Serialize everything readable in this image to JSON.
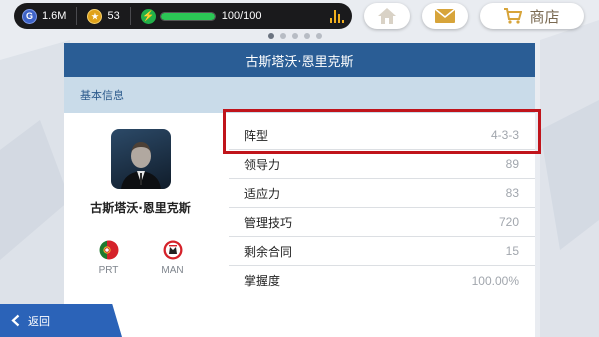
{
  "topbar": {
    "gold_icon_letter": "G",
    "gold_value": "1.6M",
    "coin_icon": "star-coin-icon",
    "coin_value": "53",
    "energy_icon": "lightning-icon",
    "energy_fraction": 1.0,
    "energy_value": "100/100",
    "stats_icon": "bar-chart-icon"
  },
  "header_buttons": {
    "home_icon": "home-icon",
    "mail_icon": "envelope-icon",
    "shop_icon": "cart-icon",
    "shop_label": "商店"
  },
  "pagination": {
    "count": 5,
    "active_index": 0
  },
  "panel": {
    "title": "古斯塔沃·恩里克斯",
    "section_title": "基本信息",
    "player_name": "古斯塔沃·恩里克斯",
    "badges": [
      {
        "icon": "portugal-flag-icon",
        "code": "PRT"
      },
      {
        "icon": "club-crest-icon",
        "code": "MAN"
      }
    ],
    "rows": [
      {
        "label": "阵型",
        "value": "4-3-3"
      },
      {
        "label": "领导力",
        "value": "89"
      },
      {
        "label": "适应力",
        "value": "83"
      },
      {
        "label": "管理技巧",
        "value": "720"
      },
      {
        "label": "剩余合同",
        "value": "15"
      },
      {
        "label": "掌握度",
        "value": "100.00%"
      }
    ]
  },
  "back_button": {
    "label": "返回"
  },
  "colors": {
    "header_blue": "#2a5d95",
    "section_blue": "#c9dbe9",
    "highlight_red": "#c0141b",
    "back_blue": "#2b63b8",
    "energy_green": "#2bc655"
  }
}
